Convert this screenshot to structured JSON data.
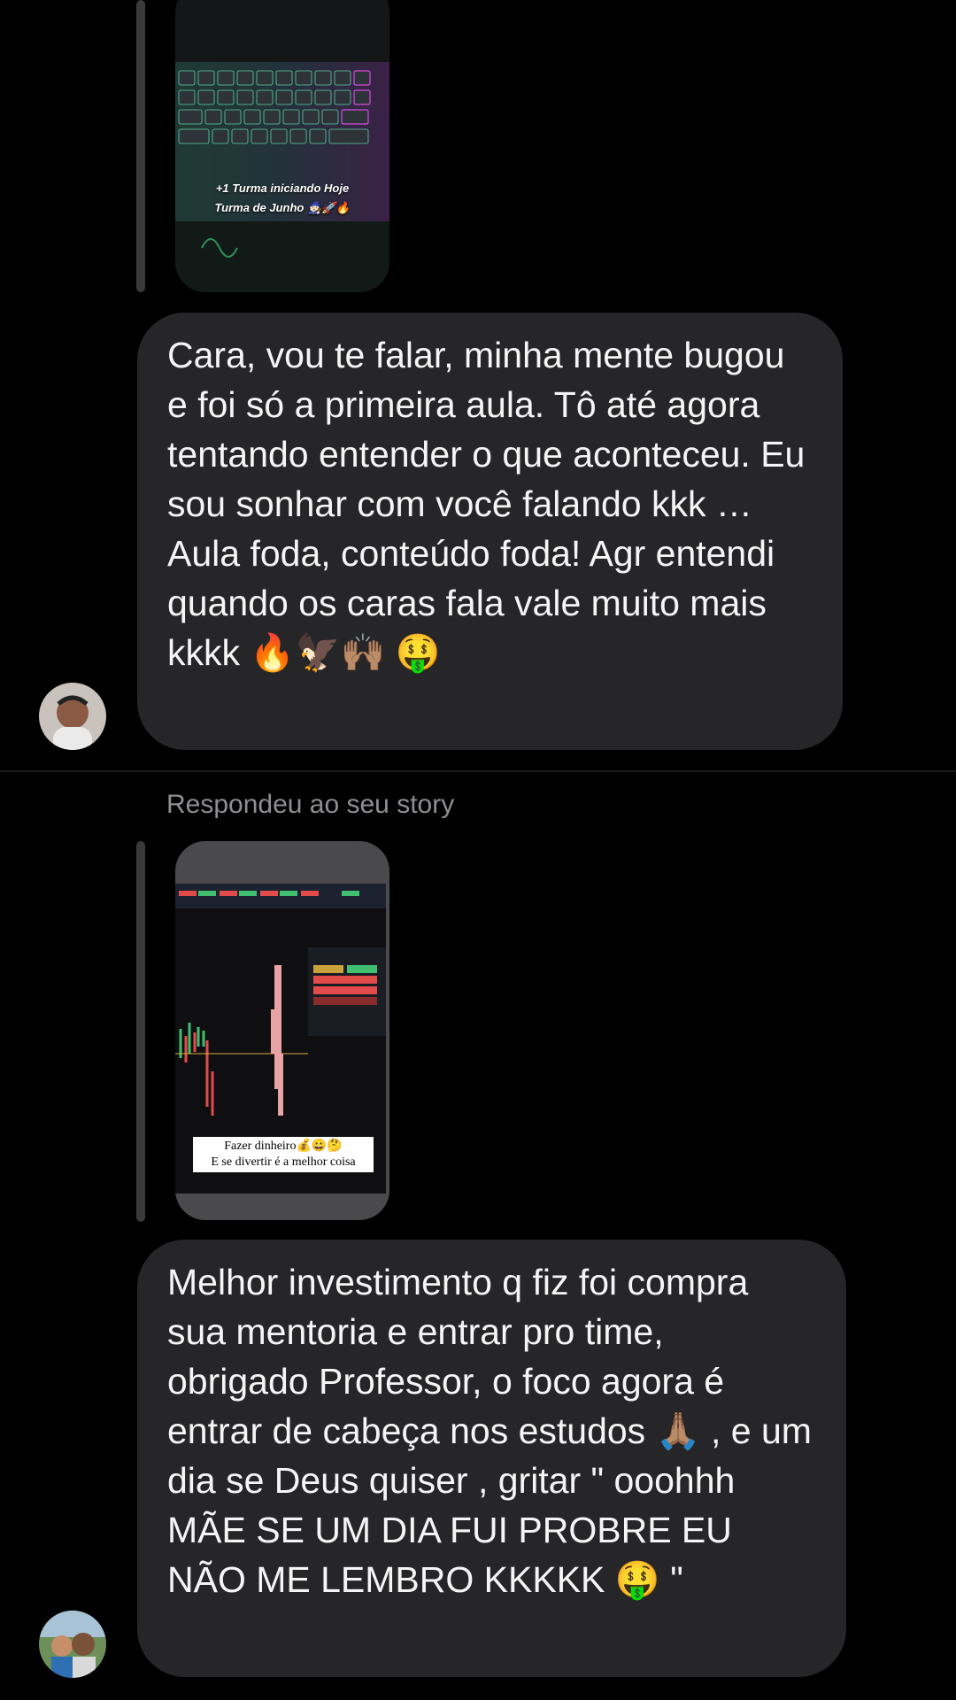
{
  "messages": [
    {
      "story": {
        "caption_line1": "+1 Turma iniciando Hoje",
        "caption_line2": "Turma de Junho 🧙🏻🚀🔥"
      },
      "text": "Cara, vou te falar, minha mente bugou e foi só a primeira aula. Tô até agora tentando entender o que aconteceu. Eu sou sonhar com você falando  kkk … Aula foda, conteúdo foda! Agr entendi quando os caras fala vale muito mais kkkk 🔥🦅🙌🏽 🤑"
    },
    {
      "replied_label": "Respondeu ao seu story",
      "story": {
        "caption_line1": "Fazer dinheiro💰😀🤔",
        "caption_line2": "E se divertir é a melhor coisa"
      },
      "text": "Melhor investimento q fiz foi compra sua mentoria e entrar pro time, obrigado Professor,  o foco agora é entrar de cabeça nos estudos 🙏🏽 , e um dia se Deus quiser , gritar      \" ooohhh MÃE SE UM DIA FUI PROBRE EU NÃO ME LEMBRO KKKKK 🤑 \""
    }
  ],
  "colors": {
    "background": "#000000",
    "bubble": "#262628",
    "secondary_text": "#8e8e93"
  },
  "icons": [
    "avatar-1",
    "avatar-2"
  ]
}
